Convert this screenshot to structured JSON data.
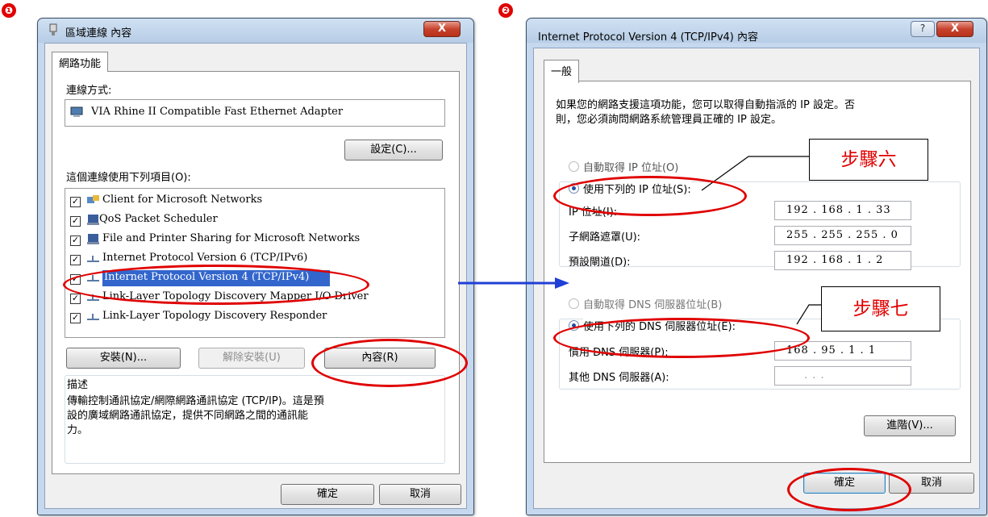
{
  "steps": [
    "❶",
    "❷"
  ],
  "left_dialog": {
    "title": "區域連線 內容",
    "close_label": "X",
    "tab": "網路功能",
    "connect_using_label": "連線方式:",
    "adapter_name": "VIA Rhine II Compatible Fast Ethernet Adapter",
    "configure_label": "設定(C)...",
    "items_label": "這個連線使用下列項目(O):",
    "items": [
      {
        "label": "Client for Microsoft Networks",
        "checked": true
      },
      {
        "label": "QoS Packet Scheduler",
        "checked": true
      },
      {
        "label": "File and Printer Sharing for Microsoft Networks",
        "checked": true
      },
      {
        "label": "Internet Protocol Version 6 (TCP/IPv6)",
        "checked": true
      },
      {
        "label": "Internet Protocol Version 4 (TCP/IPv4)",
        "checked": true
      },
      {
        "label": "Link-Layer Topology Discovery Mapper I/O Driver",
        "checked": true
      },
      {
        "label": "Link-Layer Topology Discovery Responder",
        "checked": true
      }
    ],
    "install_label": "安裝(N)...",
    "uninstall_label": "解除安裝(U)",
    "properties_label": "內容(R)",
    "description_title": "描述",
    "description_text_1": "傳輸控制通訊協定/網際網路通訊協定 (TCP/IP)。這是預",
    "description_text_2": "設的廣域網路通訊協定，提供不同網路之間的通訊能",
    "description_text_3": "力。",
    "ok_label": "確定",
    "cancel_label": "取消"
  },
  "right_dialog": {
    "title": "Internet Protocol Version 4 (TCP/IPv4) 內容",
    "help_label": "?",
    "close_label": "X",
    "tab": "一般",
    "intro_1": "如果您的網路支援這項功能，您可以取得自動指派的 IP 設定。否",
    "intro_2": "則，您必須詢問網路系統管理員正確的 IP 設定。",
    "auto_ip_label": "自動取得 IP 位址(O)",
    "manual_ip_label": "使用下列的 IP 位址(S):",
    "ip_label": "IP 位址(I):",
    "ip_value": "192 . 168 .  1  . 33",
    "mask_label": "子網路遮罩(U):",
    "mask_value": "255 . 255 . 255 .  0",
    "gateway_label": "預設閘道(D):",
    "gateway_value": "192 . 168 .  1  .  2",
    "auto_dns_label": "自動取得 DNS 伺服器位址(B)",
    "manual_dns_label": "使用下列的 DNS 伺服器位址(E):",
    "preferred_dns_label": "慣用 DNS 伺服器(P):",
    "preferred_dns_value": "168 .  95 .  1  .  1",
    "alternate_dns_label": "其他 DNS 伺服器(A):",
    "alternate_dns_value": ".       .       .",
    "advanced_label": "進階(V)...",
    "ok_label": "確定",
    "cancel_label": "取消"
  },
  "annotations": {
    "step6": "步驟六",
    "step7": "步驟七",
    "color": "#e00000",
    "arrow_color": "#1f3fd6"
  }
}
